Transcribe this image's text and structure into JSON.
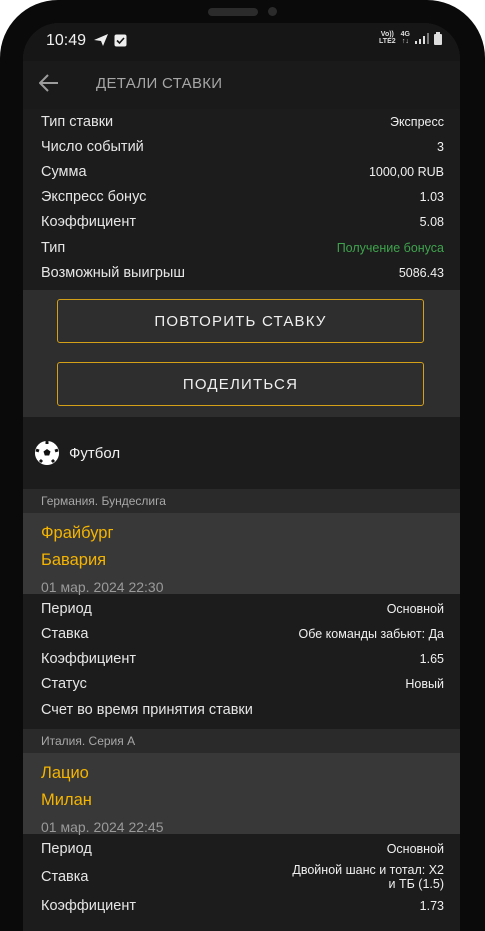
{
  "status_bar": {
    "time": "10:49",
    "network_top": "Vo))",
    "network_bottom": "LTE2",
    "signal_label": "4G"
  },
  "app_bar": {
    "title": "ДЕТАЛИ СТАВКИ"
  },
  "summary": [
    {
      "label": "Тип ставки",
      "value": "Экспресс"
    },
    {
      "label": "Число событий",
      "value": "3"
    },
    {
      "label": "Сумма",
      "value": "1000,00 RUB"
    },
    {
      "label": "Экспресс бонус",
      "value": "1.03"
    },
    {
      "label": "Коэффициент",
      "value": "5.08"
    },
    {
      "label": "Тип",
      "value": "Получение бонуса"
    },
    {
      "label": "Возможный выигрыш",
      "value": "5086.43"
    }
  ],
  "buttons": {
    "repeat": "ПОВТОРИТЬ СТАВКУ",
    "share": "ПОДЕЛИТЬСЯ"
  },
  "sport": {
    "name": "Футбол"
  },
  "events": [
    {
      "league": "Германия. Бундеслига",
      "team1": "Фрайбург",
      "team2": "Бавария",
      "date": "01 мар. 2024 22:30",
      "rows": [
        {
          "label": "Период",
          "value": "Основной"
        },
        {
          "label": "Ставка",
          "value": "Обе команды забьют: Да"
        },
        {
          "label": "Коэффициент",
          "value": "1.65"
        },
        {
          "label": "Статус",
          "value": "Новый"
        }
      ],
      "score_label": "Счет во время принятия ставки"
    },
    {
      "league": "Италия. Серия А",
      "team1": "Лацио",
      "team2": "Милан",
      "date": "01 мар. 2024 22:45",
      "rows": [
        {
          "label": "Период",
          "value": "Основной"
        },
        {
          "label": "Ставка",
          "value_line1": "Двойной шанс и тотал: X2",
          "value_line2": "и ТБ (1.5)"
        },
        {
          "label": "Коэффициент",
          "value": "1.73"
        }
      ]
    }
  ],
  "colors": {
    "accent": "#f4b400",
    "button_border": "#d4a017",
    "bonus_green": "#3fa34d",
    "background": "#1c1c1c"
  }
}
